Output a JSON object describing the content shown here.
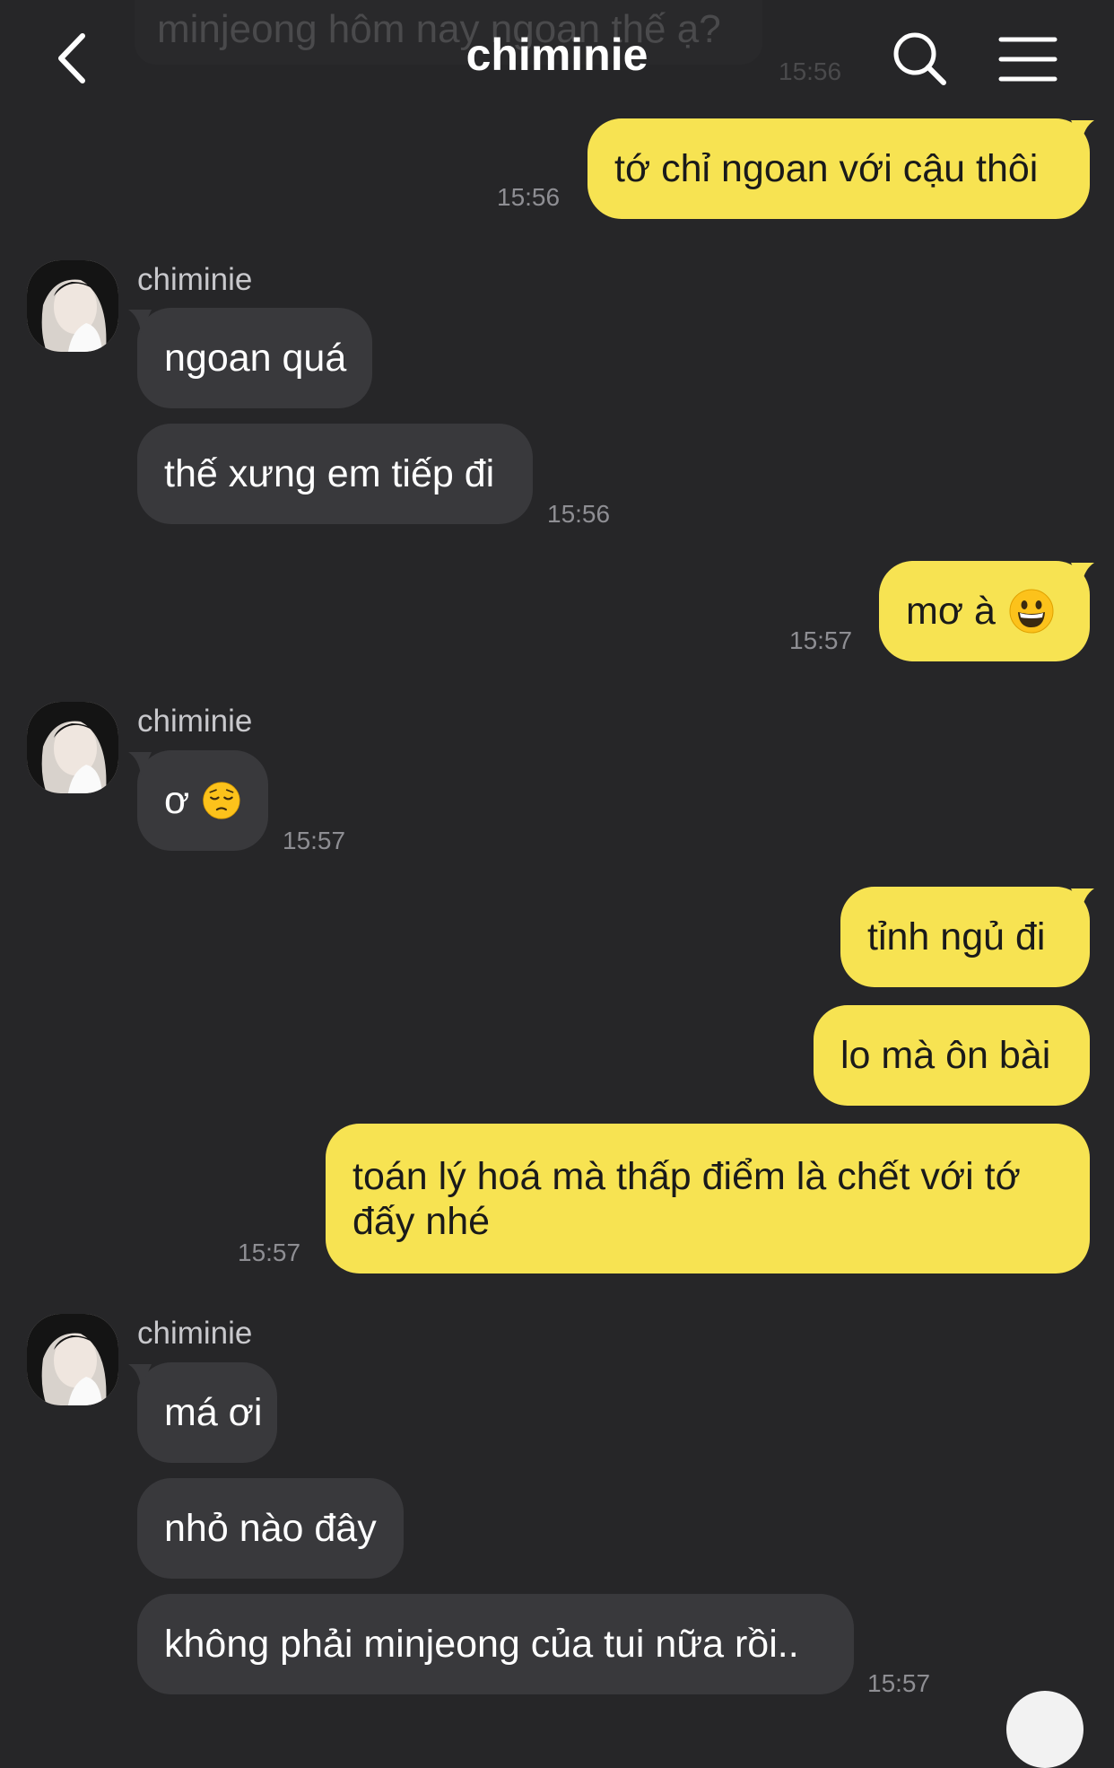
{
  "header": {
    "title": "chiminie",
    "back_icon": "chevron-left-icon",
    "search_icon": "search-icon",
    "menu_icon": "hamburger-menu-icon"
  },
  "colors": {
    "background": "#262628",
    "my_bubble": "#f7e352",
    "their_bubble": "#39393c",
    "timestamp": "#8e8e93"
  },
  "previous_message": {
    "text": "minjeong hôm nay ngoan thế ạ?",
    "time": "15:56"
  },
  "messages": {
    "m1": {
      "text": "tớ chỉ ngoan với cậu thôi",
      "time": "15:56"
    },
    "g1": {
      "sender": "chiminie",
      "b1": "ngoan quá",
      "b2": "thế xưng em tiếp đi",
      "time": "15:56"
    },
    "m2": {
      "text": "mơ à",
      "emoji": "grinning-face-emoji",
      "time": "15:57"
    },
    "g2": {
      "sender": "chiminie",
      "b1": "ơ",
      "emoji": "pensive-face-emoji",
      "time": "15:57"
    },
    "m3": {
      "b1": "tỉnh ngủ đi",
      "b2": "lo mà ôn bài",
      "b3": "toán lý hoá mà thấp điểm là chết với tớ đấy nhé",
      "time": "15:57"
    },
    "g3": {
      "sender": "chiminie",
      "b1": "má ơi",
      "b2": "nhỏ nào đây",
      "b3": "không phải minjeong của tui nữa rồi..",
      "time": "15:57"
    }
  }
}
